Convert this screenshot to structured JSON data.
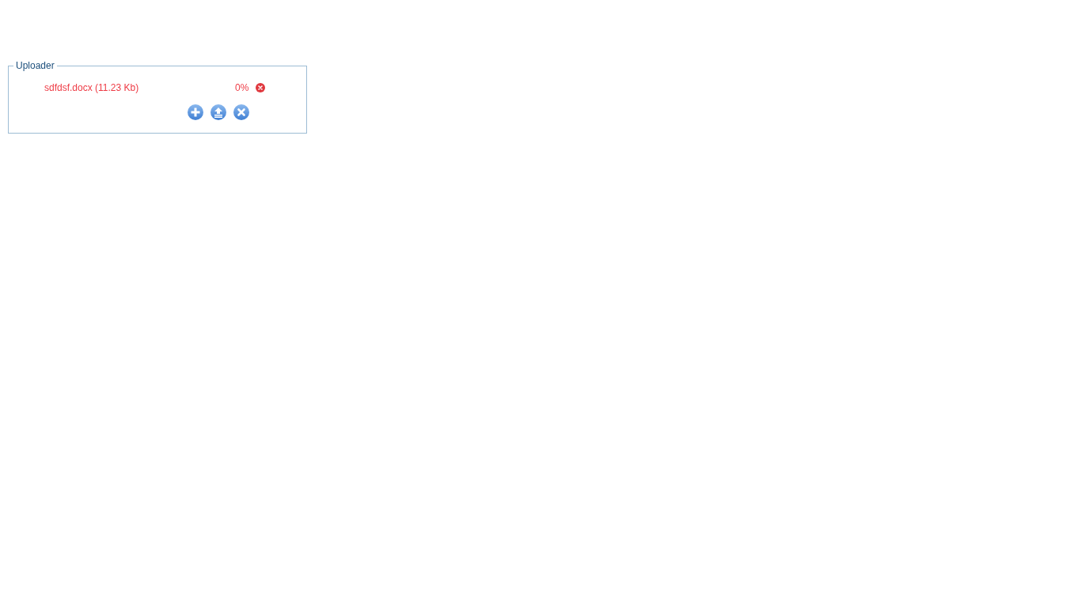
{
  "uploader": {
    "title": "Uploader",
    "files": [
      {
        "name": "sdfdsf.docx (11.23 Kb)",
        "progress": "0%"
      }
    ],
    "buttons": [
      {
        "kind": "add"
      },
      {
        "kind": "upload"
      },
      {
        "kind": "cancel"
      }
    ]
  }
}
